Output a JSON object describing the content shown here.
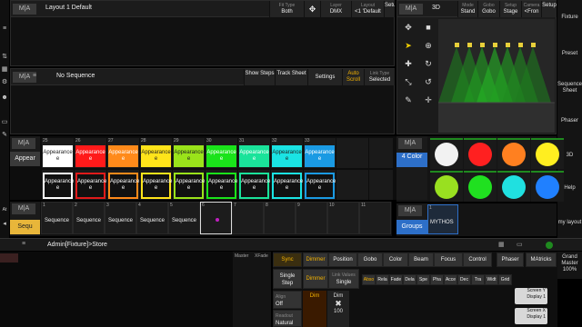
{
  "logo": "M|A",
  "layout": {
    "title": "Layout 1 Default",
    "buttons": [
      {
        "small": "Fit Type",
        "label": "Both"
      },
      {
        "small": "",
        "label": "✥"
      },
      {
        "small": "Layer",
        "label": "DMX"
      },
      {
        "small": "Layout",
        "label": "<1 'Default"
      },
      {
        "small": "",
        "label": "Setup"
      }
    ]
  },
  "viewer3d": {
    "label": "3D",
    "tabs": [
      {
        "small": "Mode",
        "label": "Stand"
      },
      {
        "small": "Gobo",
        "label": "Gobo"
      },
      {
        "small": "Setup",
        "label": "Stage"
      },
      {
        "small": "Camera",
        "label": "<Fron"
      },
      {
        "small": "",
        "label": "Setup"
      }
    ]
  },
  "sequence": {
    "title": "No Sequence",
    "buttons": [
      {
        "small": "",
        "label": "Show Steps"
      },
      {
        "small": "",
        "label": "Track Sheet"
      },
      {
        "small": "",
        "label": "Settings"
      },
      {
        "small": "",
        "label": "Auto Scroll"
      },
      {
        "small": "Link Type",
        "label": "Selected"
      }
    ]
  },
  "appearances": {
    "header": "Appear",
    "numbers_row1": [
      "25",
      "26",
      "27",
      "28",
      "29",
      "30",
      "31",
      "32",
      "33"
    ],
    "label": "Appearance",
    "sub": "e",
    "colors_row1": [
      "#ffffff",
      "#ff1a1a",
      "#ff8a1a",
      "#ffe41a",
      "#9ae31a",
      "#1ae31a",
      "#1ae39a",
      "#1ae3e3",
      "#1a9ae3"
    ],
    "colors_row2": [
      "#ffffff",
      "#e01a1a",
      "#ff8a1a",
      "#ffe41a",
      "#9ae31a",
      "#1ae31a",
      "#1ae39a",
      "#1ae3e3",
      "#1a9ae3"
    ]
  },
  "colorpool": {
    "header": "4 Color",
    "row1": [
      "#f2f2f2",
      "#ff2020",
      "#ff8020",
      "#ffee20"
    ],
    "row2": [
      "#99e020",
      "#20e020",
      "#20e0e0",
      "#2080ff"
    ]
  },
  "sequences": {
    "header": "Sequ",
    "items": [
      "Sequence",
      "Sequence",
      "Sequence",
      "Sequence",
      "Sequence"
    ],
    "numbers": [
      "1",
      "2",
      "3",
      "4",
      "5",
      "6",
      "7",
      "8",
      "9",
      "10",
      "11"
    ]
  },
  "groups": {
    "header": "Groups",
    "item": "MYTHOS",
    "numbers": [
      "1",
      "2",
      "3",
      "4",
      "5",
      "6",
      "7",
      "8"
    ]
  },
  "right_bar": {
    "items": [
      "Fixture",
      "Preset",
      "Sequence Sheet",
      "Phaser",
      "3D",
      "Help",
      "my layout"
    ],
    "bottom": [
      "Grand Master",
      "100%"
    ]
  },
  "command": {
    "text": "Admin[Fixture]>Store"
  },
  "bottom": {
    "master_labels": [
      "Master",
      "XFade"
    ],
    "features": [
      "Sync",
      "Dimmer",
      "Position",
      "Gobo",
      "Color",
      "Beam",
      "Focus",
      "Control",
      "Phaser",
      "MAtricks"
    ],
    "row2": [
      {
        "small": "",
        "label": "Single Step"
      },
      {
        "small": "",
        "label": "Dimmer"
      },
      {
        "small": "Link Values",
        "label": "Single"
      }
    ],
    "attrs": [
      "Abso",
      "Rela",
      "Fade",
      "Dela",
      "Spe",
      "Pha",
      "Acce",
      "Dec",
      "Tra",
      "Widt",
      "Grid"
    ],
    "align": {
      "small": "Align",
      "label": "Off"
    },
    "readout": {
      "small": "Readout",
      "label": "Natural"
    },
    "dim1": "Dim",
    "dim2": "Dim",
    "pct": "100",
    "screens": [
      "Screen Y",
      "Display 1",
      "Screen X",
      "Display 1"
    ]
  }
}
